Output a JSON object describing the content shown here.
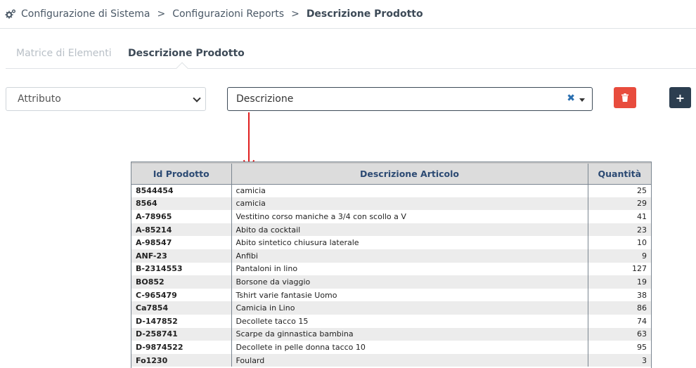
{
  "breadcrumb": {
    "items": [
      "Configurazione di Sistema",
      "Configurazioni Reports"
    ],
    "current": "Descrizione Prodotto",
    "separator": ">"
  },
  "tabs": [
    {
      "label": "Matrice di Elementi",
      "active": false
    },
    {
      "label": "Descrizione Prodotto",
      "active": true
    }
  ],
  "controls": {
    "attribute_select": "Attributo",
    "description_select": "Descrizione",
    "clear_symbol": "✖",
    "add_symbol": "+"
  },
  "colors": {
    "delete": "#e84c3d",
    "add": "#2c3e50",
    "annotation_arrow": "#e01e1e",
    "header_text": "#2c4a73"
  },
  "report": {
    "columns": [
      "Id Prodotto",
      "Descrizione Articolo",
      "Quantità"
    ],
    "rows": [
      {
        "id": "8544454",
        "desc": "camicia",
        "qty": "25"
      },
      {
        "id": "8564",
        "desc": "camicia",
        "qty": "29"
      },
      {
        "id": "A-78965",
        "desc": "Vestitino corso maniche a 3/4 con scollo a V",
        "qty": "41"
      },
      {
        "id": "A-85214",
        "desc": "Abito da cocktail",
        "qty": "23"
      },
      {
        "id": "A-98547",
        "desc": "Abito sintetico chiusura laterale",
        "qty": "10"
      },
      {
        "id": "ANF-23",
        "desc": "Anfibi",
        "qty": "9"
      },
      {
        "id": "B-2314553",
        "desc": "Pantaloni in lino",
        "qty": "127"
      },
      {
        "id": "BO852",
        "desc": "Borsone da viaggio",
        "qty": "19"
      },
      {
        "id": "C-965479",
        "desc": "Tshirt varie fantasie Uomo",
        "qty": "38"
      },
      {
        "id": "Ca7854",
        "desc": "Camicia in Lino",
        "qty": "86"
      },
      {
        "id": "D-147852",
        "desc": "Decollete tacco 15",
        "qty": "74"
      },
      {
        "id": "D-258741",
        "desc": "Scarpe da ginnastica bambina",
        "qty": "63"
      },
      {
        "id": "D-9874522",
        "desc": "Decollete in pelle donna tacco 10",
        "qty": "95"
      },
      {
        "id": "Fo1230",
        "desc": "Foulard",
        "qty": "3"
      }
    ]
  },
  "icons": {
    "breadcrumb": "gears-icon",
    "delete": "trash-icon",
    "add": "plus-icon",
    "select": "chevron-down-icon"
  }
}
